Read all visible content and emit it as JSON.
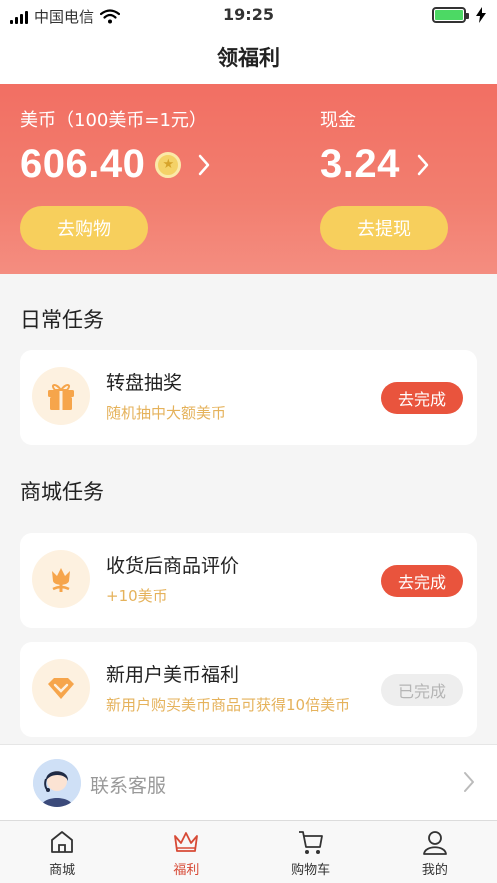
{
  "status_bar": {
    "carrier": "中国电信",
    "time": "19:25"
  },
  "nav": {
    "title": "领福利"
  },
  "banner": {
    "coins": {
      "label": "美币（100美币=1元）",
      "value": "606.40",
      "button": "去购物"
    },
    "cash": {
      "label": "现金",
      "value": "3.24",
      "button": "去提现"
    }
  },
  "daily": {
    "title": "日常任务",
    "tasks": [
      {
        "title": "转盘抽奖",
        "subtitle": "随机抽中大额美币",
        "action": "去完成",
        "icon": "gift-icon"
      }
    ]
  },
  "mall": {
    "title": "商城任务",
    "tasks": [
      {
        "title": "收货后商品评价",
        "subtitle": "+10美币",
        "action": "去完成",
        "icon": "flower-icon"
      },
      {
        "title": "新用户美币福利",
        "subtitle": "新用户购买美币商品可获得10倍美币",
        "action": "已完成",
        "icon": "diamond-icon"
      }
    ]
  },
  "contact": {
    "label": "联系客服"
  },
  "tabs": [
    {
      "label": "商城",
      "icon": "home-icon"
    },
    {
      "label": "福利",
      "icon": "crown-icon"
    },
    {
      "label": "购物车",
      "icon": "cart-icon"
    },
    {
      "label": "我的",
      "icon": "user-icon"
    }
  ],
  "colors": {
    "accent": "#e9543d",
    "banner": "#f27e6f",
    "button_yellow": "#f7cf5c",
    "subtitle": "#e5b25b"
  }
}
